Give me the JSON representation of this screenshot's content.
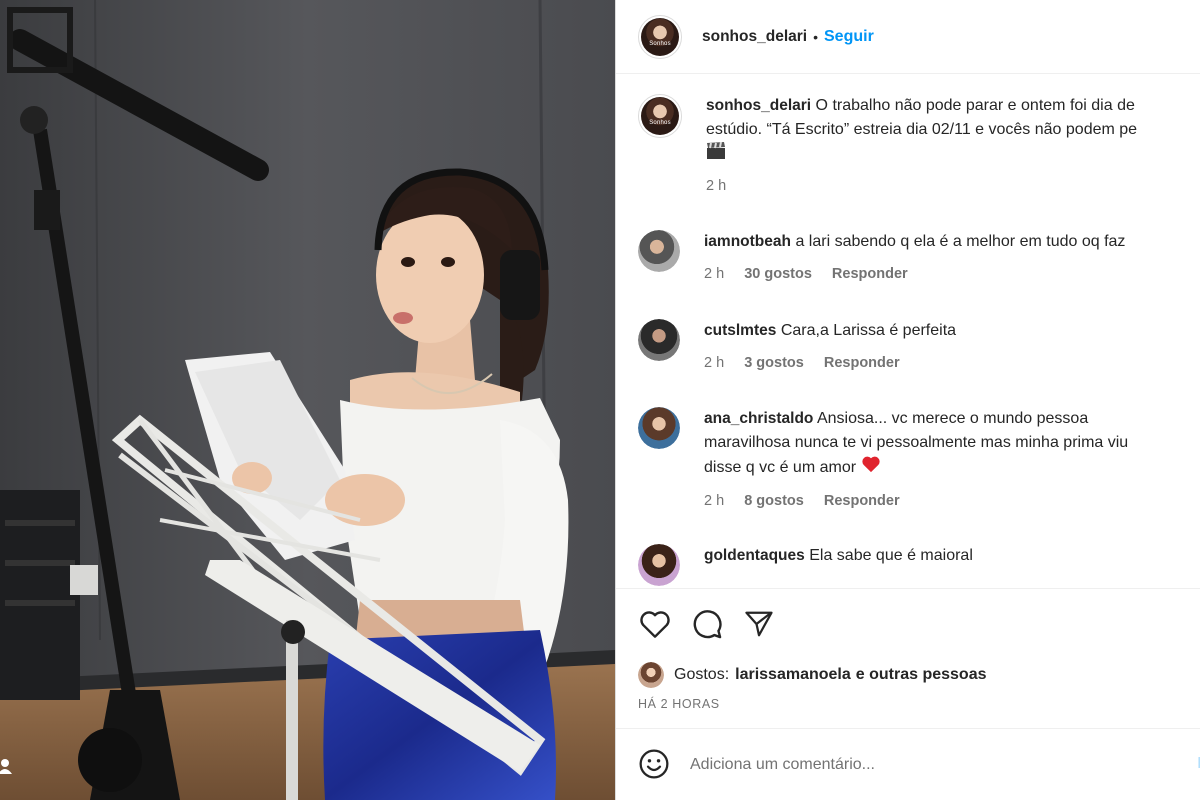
{
  "post": {
    "username": "sonhos_delari",
    "separator": "•",
    "follow_label": "Seguir",
    "avatar_text": "Sonhos"
  },
  "caption": {
    "username": "sonhos_delari",
    "line1": "O trabalho não pode parar e ontem foi dia de",
    "line2": "estúdio. “Tá Escrito” estreia dia 02/11 e vocês não podem pe",
    "time": "2 h"
  },
  "comments": [
    {
      "username": "iamnotbeah",
      "text": "a lari sabendo q ela é a melhor em tudo oq faz",
      "time": "2 h",
      "likes": "30 gostos",
      "reply": "Responder"
    },
    {
      "username": "cutslmtes",
      "text": "Cara,a Larissa é perfeita",
      "time": "2 h",
      "likes": "3 gostos",
      "reply": "Responder"
    },
    {
      "username": "ana_christaldo",
      "line1": "Ansiosa... vc merece o mundo pessoa",
      "line2": "maravilhosa nunca te vi pessoalmente mas minha prima viu",
      "line3": "disse q vc é um amor",
      "time": "2 h",
      "likes": "8 gostos",
      "reply": "Responder"
    },
    {
      "username": "goldentaques",
      "text": "Ela sabe que é maioral"
    }
  ],
  "likes": {
    "label": "Gostos:",
    "user": "larissamanoela",
    "rest": "e outras pessoas"
  },
  "timeago": "HÁ 2 HORAS",
  "add_comment": {
    "placeholder": "Adiciona um comentário...",
    "post_label": "P"
  },
  "icons": [
    "heart-icon",
    "comment-icon",
    "share-icon",
    "emoji-icon",
    "tag-user-icon"
  ]
}
